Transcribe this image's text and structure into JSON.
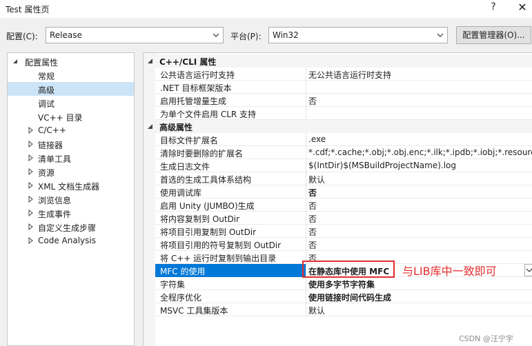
{
  "window": {
    "title": "Test 属性页",
    "help_glyph": "?",
    "close_glyph": "✕"
  },
  "toolbar": {
    "config_label": "配置(C):",
    "config_value": "Release",
    "platform_label": "平台(P):",
    "platform_value": "Win32",
    "config_manager_label": "配置管理器(O)..."
  },
  "tree": {
    "items": [
      {
        "label": "配置属性",
        "expanded": true
      },
      {
        "label": "常规"
      },
      {
        "label": "高级",
        "selected": true
      },
      {
        "label": "调试"
      },
      {
        "label": "VC++ 目录"
      },
      {
        "label": "C/C++"
      },
      {
        "label": "链接器"
      },
      {
        "label": "清单工具"
      },
      {
        "label": "资源"
      },
      {
        "label": "XML 文档生成器"
      },
      {
        "label": "浏览信息"
      },
      {
        "label": "生成事件"
      },
      {
        "label": "自定义生成步骤"
      },
      {
        "label": "Code Analysis"
      }
    ]
  },
  "grid": {
    "categories": [
      {
        "label": "C++/CLI 属性",
        "rows": [
          {
            "name": "公共语言运行时支持",
            "value": "无公共语言运行时支持"
          },
          {
            "name": ".NET 目标框架版本",
            "value": ""
          },
          {
            "name": "启用托管增量生成",
            "value": "否"
          },
          {
            "name": "为单个文件启用 CLR 支持",
            "value": ""
          }
        ]
      },
      {
        "label": "高级属性",
        "rows": [
          {
            "name": "目标文件扩展名",
            "value": ".exe"
          },
          {
            "name": "清除时要删除的扩展名",
            "value": "*.cdf;*.cache;*.obj;*.obj.enc;*.ilk;*.ipdb;*.iobj;*.resources;*"
          },
          {
            "name": "生成日志文件",
            "value": "$(IntDir)$(MSBuildProjectName).log"
          },
          {
            "name": "首选的生成工具体系结构",
            "value": "默认"
          },
          {
            "name": "使用调试库",
            "value": "否",
            "bold": true
          },
          {
            "name": "启用 Unity (JUMBO)生成",
            "value": "否"
          },
          {
            "name": "将内容复制到 OutDir",
            "value": "否"
          },
          {
            "name": "将项目引用复制到 OutDir",
            "value": "否"
          },
          {
            "name": "将项目引用的符号复制到 OutDir",
            "value": "否"
          },
          {
            "name": "将 C++ 运行时复制到输出目录",
            "value": "否"
          },
          {
            "name": "MFC 的使用",
            "value": "在静态库中使用 MFC",
            "bold": true,
            "selected": true
          },
          {
            "name": "字符集",
            "value": "使用多字节字符集",
            "bold": true
          },
          {
            "name": "全程序优化",
            "value": "使用链接时间代码生成",
            "bold": true
          },
          {
            "name": "MSVC 工具集版本",
            "value": "默认"
          }
        ]
      }
    ]
  },
  "annotation": {
    "text": "与LIB库中一致即可",
    "color": "#e32d2d"
  },
  "watermark": "CSDN @汪宁宇",
  "colors": {
    "selection": "#0078d7",
    "tree_selection": "#cce4f7",
    "annotation": "#e32d2d"
  }
}
